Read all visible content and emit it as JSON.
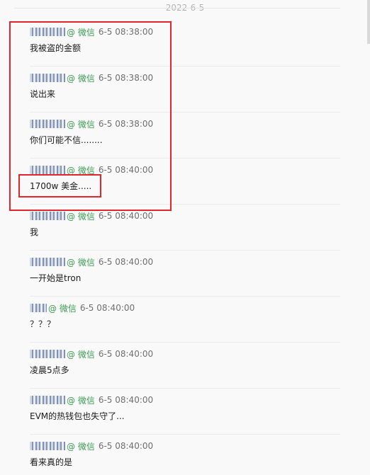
{
  "date_header": "2022-6-5",
  "messages": [
    {
      "source": "@ 微信",
      "time": "6-5 08:38:00",
      "text": "我被盗的金额"
    },
    {
      "source": "@ 微信",
      "time": "6-5 08:38:00",
      "text": "说出来"
    },
    {
      "source": "@ 微信",
      "time": "6-5 08:38:00",
      "text": "你们可能不信........"
    },
    {
      "source": "@ 微信",
      "time": "6-5 08:40:00",
      "text": "1700w 美金....."
    },
    {
      "source": "@ 微信",
      "time": "6-5 08:40:00",
      "text": "我"
    },
    {
      "source": "@ 微信",
      "time": "6-5 08:40:00",
      "text": "一开始是tron"
    },
    {
      "source": "@ 微信",
      "time": "6-5 08:40:00",
      "text": "？？？"
    },
    {
      "source": "@ 微信",
      "time": "6-5 08:40:00",
      "text": "凌晨5点多"
    },
    {
      "source": "@ 微信",
      "time": "6-5 08:40:00",
      "text": "EVM的热钱包也失守了..."
    },
    {
      "source": "@ 微信",
      "time": "6-5 08:40:00",
      "text": "看来真的是"
    }
  ]
}
